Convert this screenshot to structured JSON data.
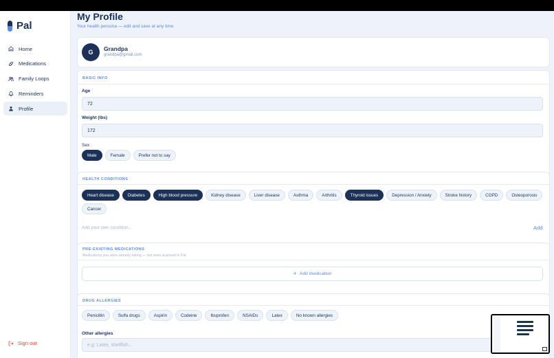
{
  "app": {
    "name": "Pal"
  },
  "sidebar": {
    "items": [
      {
        "label": "Home",
        "icon": "home-icon"
      },
      {
        "label": "Medications",
        "icon": "pill-icon"
      },
      {
        "label": "Family Loops",
        "icon": "users-icon"
      },
      {
        "label": "Reminders",
        "icon": "bell-icon"
      },
      {
        "label": "Profile",
        "icon": "user-icon",
        "active": true
      }
    ],
    "signout": "Sign out"
  },
  "page": {
    "title": "My Profile",
    "subtitle": "Your health persona — edit and save at any time"
  },
  "profile": {
    "initial": "G",
    "name": "Grandpa",
    "email": "grandpa@gmail.com"
  },
  "basic_info": {
    "title": "BASIC INFO",
    "age_label": "Age",
    "age_value": "72",
    "weight_label": "Weight (lbs)",
    "weight_value": "172",
    "sex_label": "Sex",
    "sex_options": [
      {
        "label": "Male",
        "selected": true
      },
      {
        "label": "Female",
        "selected": false
      },
      {
        "label": "Prefer not to say",
        "selected": false
      }
    ]
  },
  "health_conditions": {
    "title": "HEALTH CONDITIONS",
    "options": [
      {
        "label": "Heart disease",
        "selected": true
      },
      {
        "label": "Diabetes",
        "selected": true
      },
      {
        "label": "High blood pressure",
        "selected": true
      },
      {
        "label": "Kidney disease",
        "selected": false
      },
      {
        "label": "Liver disease",
        "selected": false
      },
      {
        "label": "Asthma",
        "selected": false
      },
      {
        "label": "Arthritis",
        "selected": false
      },
      {
        "label": "Thyroid issues",
        "selected": true
      },
      {
        "label": "Depression / Anxiety",
        "selected": false
      },
      {
        "label": "Stroke history",
        "selected": false
      },
      {
        "label": "COPD",
        "selected": false
      },
      {
        "label": "Osteoporosis",
        "selected": false
      },
      {
        "label": "Cancer",
        "selected": false
      }
    ],
    "custom_placeholder": "Add your own condition...",
    "add_label": "Add"
  },
  "pre_existing_medications": {
    "title": "PRE-EXISTING MEDICATIONS",
    "subtitle": "Medications you were already taking — not ones scanned in Pal",
    "add_button": "Add medication"
  },
  "drug_allergies": {
    "title": "DRUG ALLERGIES",
    "options": [
      {
        "label": "Penicillin",
        "selected": false
      },
      {
        "label": "Sulfa drugs",
        "selected": false
      },
      {
        "label": "Aspirin",
        "selected": false
      },
      {
        "label": "Codeine",
        "selected": false
      },
      {
        "label": "Ibuprofen",
        "selected": false
      },
      {
        "label": "NSAIDs",
        "selected": false
      },
      {
        "label": "Latex",
        "selected": false
      },
      {
        "label": "No known allergies",
        "selected": false
      }
    ],
    "other_label": "Other allergies",
    "other_placeholder": "e.g. Latex, shellfish..."
  },
  "colors": {
    "navy": "#1b3158",
    "accent": "#5b8be0",
    "danger": "#d9473c",
    "background": "#eef3fa"
  }
}
